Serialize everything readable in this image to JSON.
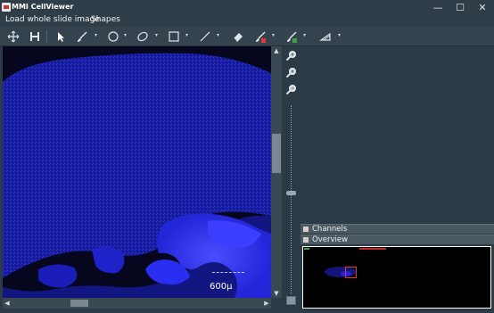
{
  "window": {
    "title": "MMI CellViewer"
  },
  "window_controls": {
    "minimize": "—",
    "maximize": "☐",
    "close": "✕"
  },
  "menu": {
    "items": [
      "Load whole slide image",
      "Shapes"
    ]
  },
  "toolbar": {
    "tools": [
      "move-icon",
      "save-icon",
      "pointer-icon",
      "brush-icon",
      "circle-icon",
      "ellipse-icon",
      "rectangle-icon",
      "line-icon",
      "eraser-icon",
      "red-pen-icon",
      "green-pen-icon",
      "ruler-icon"
    ],
    "colors": {
      "red_pen": "#e53935",
      "green_pen": "#43a047"
    }
  },
  "viewer": {
    "scale_label": "600µ"
  },
  "dock": {
    "channels": "Channels",
    "overview": "Overview"
  },
  "colors": {
    "background": "#2b3a45",
    "tissue": "#1a1fbf",
    "bright": "#3a3dff"
  }
}
